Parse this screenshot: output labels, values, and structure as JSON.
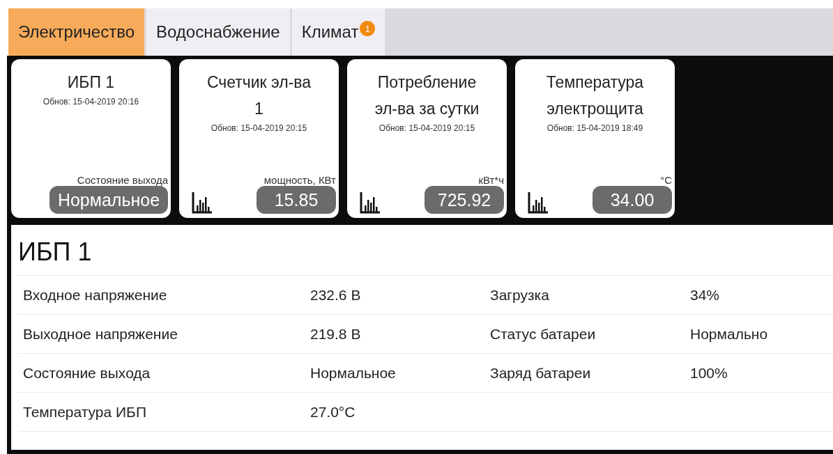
{
  "tabs": [
    {
      "label": "Электричество",
      "selected": true
    },
    {
      "label": "Водоснабжение",
      "selected": false
    },
    {
      "label": "Климат",
      "selected": false,
      "badge": "1"
    }
  ],
  "cards": [
    {
      "kind": "status",
      "title": "ИБП 1",
      "updated": "Обнов: 15-04-2019 20:16",
      "unit": "Состояние выхода",
      "value": "Нормальное"
    },
    {
      "kind": "metric",
      "title": "Счетчик эл-ва 1",
      "updated": "Обнов: 15-04-2019 20:15",
      "unit": "мощность, КВт",
      "value": "15.85"
    },
    {
      "kind": "metric",
      "title": "Потребление эл-ва за сутки",
      "updated": "Обнов: 15-04-2019 20:15",
      "unit": "кВт*ч",
      "value": "725.92"
    },
    {
      "kind": "metric",
      "title": "Температура электрощита",
      "updated": "Обнов: 15-04-2019 18:49",
      "unit": "°C",
      "value": "34.00"
    }
  ],
  "detail": {
    "title": "ИБП 1",
    "rows": [
      [
        "Входное напряжение",
        "232.6 В",
        "Загрузка",
        "34%"
      ],
      [
        "Выходное напряжение",
        "219.8 В",
        "Статус батареи",
        "Нормально"
      ],
      [
        "Состояние выхода",
        "Нормальное",
        "Заряд батареи",
        "100%"
      ],
      [
        "Температура ИБП",
        "27.0°C"
      ]
    ]
  }
}
